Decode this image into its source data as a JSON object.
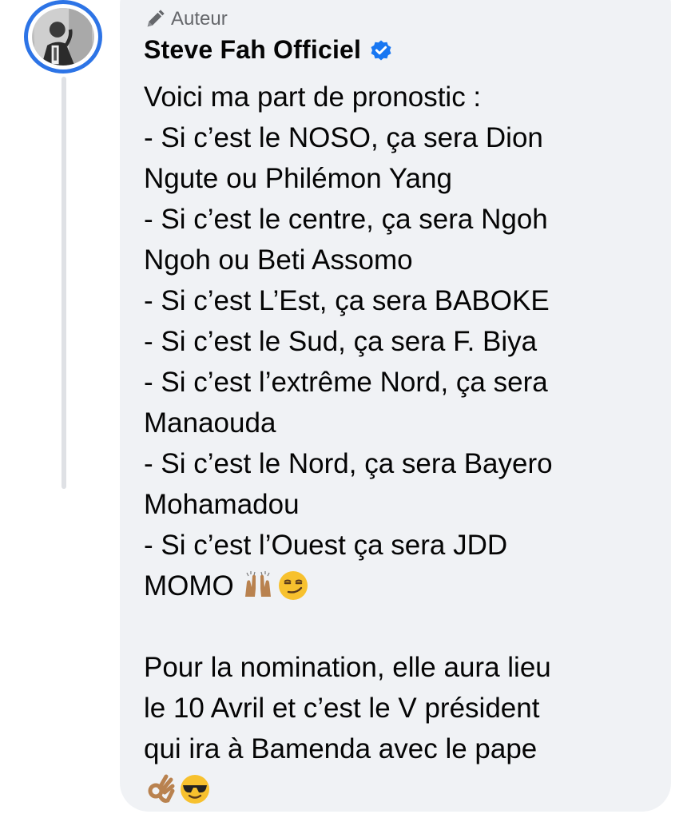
{
  "comment": {
    "badge_label": "Auteur",
    "badge_icon": "pencil-icon",
    "author_name": "Steve Fah Officiel",
    "verified_icon": "verified-check-icon",
    "accent_color": "#2d74e6",
    "lines": [
      "Voici ma part de pronostic :",
      "- Si c’est le NOSO, ça sera Dion",
      "Ngute ou Philémon Yang",
      "- Si c’est le centre, ça sera Ngoh",
      "Ngoh ou Beti Assomo",
      "- Si c’est L’Est, ça sera BABOKE",
      "- Si c’est le Sud, ça sera F. Biya",
      "- Si c’est l’extrême Nord, ça sera",
      "Manaouda",
      "- Si c’est le Nord, ça sera Bayero",
      "Mohamadou",
      "- Si c’est l’Ouest ça sera JDD",
      "MOMO"
    ],
    "lines2": [
      "Pour la nomination, elle aura lieu",
      "le 10 Avril et c’est le V président",
      "qui ira à Bamenda avec le pape"
    ],
    "emojis_line1": [
      "raised-hands-emoji",
      "smirking-face-emoji"
    ],
    "emojis_line2": [
      "ok-hand-emoji",
      "sunglasses-face-emoji"
    ]
  }
}
